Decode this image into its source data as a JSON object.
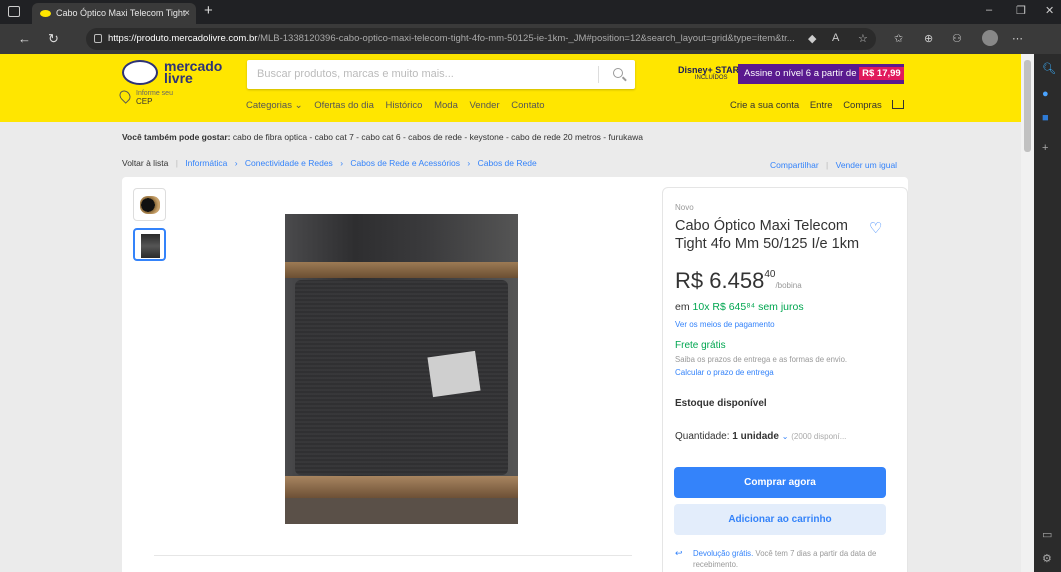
{
  "browser": {
    "tab_title": "Cabo Óptico Maxi Telecom Tight",
    "tab_close": "×",
    "new_tab": "+",
    "url_domain": "https://produto.mercadolivre.com.br",
    "url_path": "/MLB-1338120396-cabo-optico-maxi-telecom-tight-4fo-mm-50125-ie-1km-_JM#position=12&search_layout=grid&type=item&tr...",
    "zoom_text": "A"
  },
  "header": {
    "logo_line1": "mercado",
    "logo_line2": "livre",
    "cep_small": "Informe seu",
    "cep": "CEP",
    "search_placeholder": "Buscar produtos, marcas e muito mais...",
    "disney_text": "Disney+ STAR+",
    "disney_sub": "INCLUÍDOS",
    "promo_text": "Assine o nível 6 a partir de",
    "promo_price": "R$ 17,99",
    "nav": [
      "Categorias ⌄",
      "Ofertas do dia",
      "Histórico",
      "Moda",
      "Vender",
      "Contato"
    ],
    "account": [
      "Crie a sua conta",
      "Entre",
      "Compras"
    ]
  },
  "suggestions": {
    "label": "Você também pode gostar:",
    "items": "cabo de fibra optica - cabo cat 7 - cabo cat 6 - cabos de rede - keystone - cabo de rede 20 metros - furukawa"
  },
  "breadcrumb": {
    "back": "Voltar à lista",
    "items": [
      "Informática",
      "Conectividade e Redes",
      "Cabos de Rede e Acessórios",
      "Cabos de Rede"
    ]
  },
  "share": {
    "share": "Compartilhar",
    "sell": "Vender um igual"
  },
  "product": {
    "condition": "Novo",
    "title": "Cabo Óptico Maxi Telecom Tight 4fo Mm 50/125 I/e 1km",
    "price_currency": "R$",
    "price_main": "6.458",
    "price_cents": "40",
    "price_unit": "/bobina",
    "installments_prefix": "em",
    "installments_value": "10x R$ 645⁸⁴ sem juros",
    "payment_link": "Ver os meios de pagamento",
    "shipping": "Frete grátis",
    "shipping_info": "Saiba os prazos de entrega e as formas de envio.",
    "shipping_link": "Calcular o prazo de entrega",
    "stock": "Estoque disponível",
    "qty_label": "Quantidade:",
    "qty_value": "1 unidade",
    "qty_avail": "(2000 disponí...",
    "buy_now": "Comprar agora",
    "add_cart": "Adicionar ao carrinho",
    "return_strong": "Devolução grátis.",
    "return_text": "Você tem 7 dias a partir da data de recebimento."
  },
  "colors": {
    "header_yellow": "#ffe600",
    "mercado_blue": "#3483fa",
    "green": "#00a650"
  }
}
